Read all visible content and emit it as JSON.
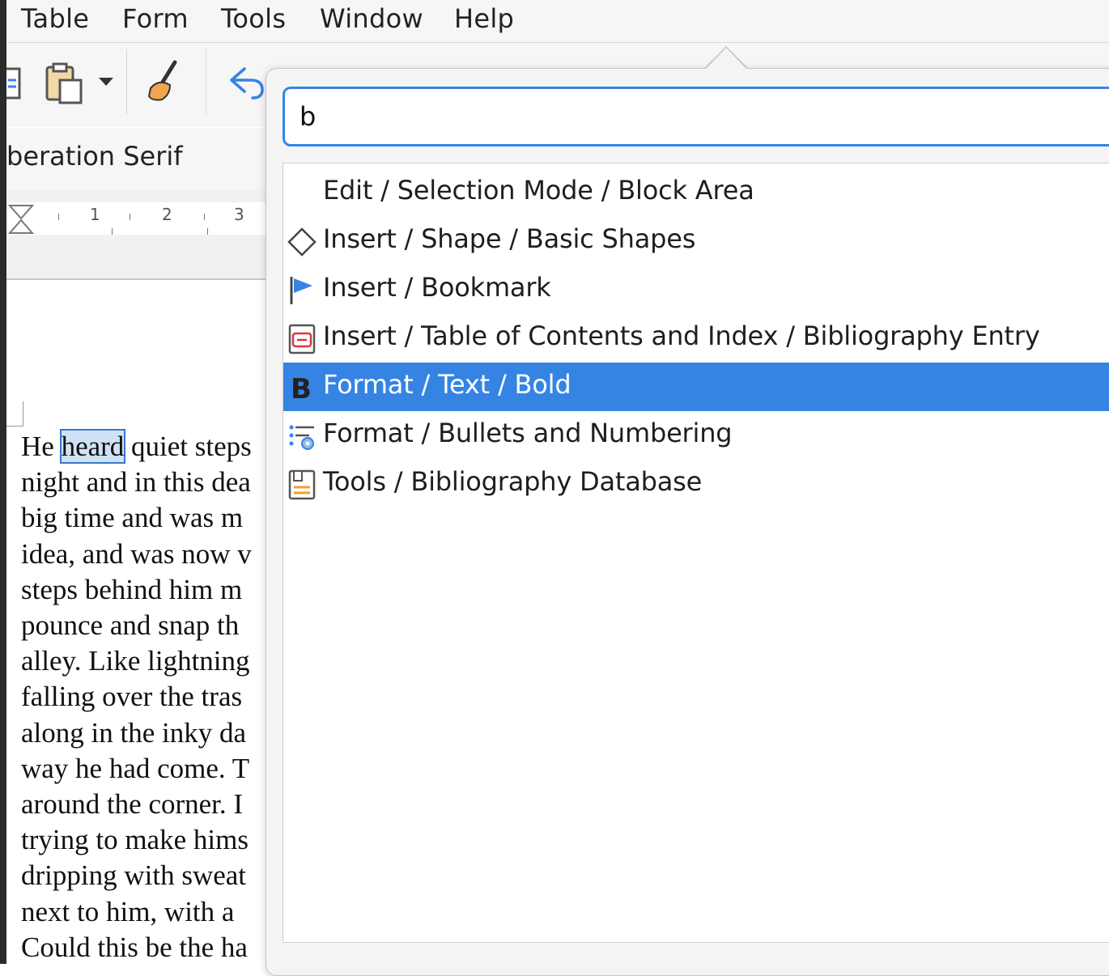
{
  "menubar": {
    "items": [
      "Table",
      "Form",
      "Tools",
      "Window",
      "Help"
    ]
  },
  "toolbar": {
    "font_name": "Liberation Serif",
    "font_name_visible": "beration Serif"
  },
  "ruler": {
    "numbers": [
      "1",
      "2",
      "3"
    ]
  },
  "document": {
    "lines": [
      {
        "before": "He ",
        "selected": "heard",
        "after": " quiet steps"
      },
      {
        "text": "night and in this dea"
      },
      {
        "text": "big time and was m"
      },
      {
        "text": "idea, and was now v"
      },
      {
        "text": "steps behind him m"
      },
      {
        "text": "pounce and snap th"
      },
      {
        "text": "alley. Like lightning"
      },
      {
        "text": "falling over the tras"
      },
      {
        "text": "along in the inky da"
      },
      {
        "text": "way he had come. T"
      },
      {
        "text": "around the corner. I"
      },
      {
        "text": "trying to make hims"
      },
      {
        "text": "dripping with sweat"
      },
      {
        "text": "next to him, with a"
      },
      {
        "text": "Could this be the ha"
      }
    ]
  },
  "command_popup": {
    "search_value": "b",
    "results": [
      {
        "label": "Edit / Selection Mode / Block Area",
        "icon": "none",
        "selected": false
      },
      {
        "label": "Insert / Shape / Basic Shapes",
        "icon": "diamond-shape-icon",
        "selected": false
      },
      {
        "label": "Insert / Bookmark",
        "icon": "bookmark-flag-icon",
        "selected": false
      },
      {
        "label": "Insert / Table of Contents and Index / Bibliography Entry",
        "icon": "bibliography-entry-icon",
        "selected": false
      },
      {
        "label": "Format / Text / Bold",
        "icon": "bold-icon",
        "selected": true
      },
      {
        "label": "Format / Bullets and Numbering",
        "icon": "bullets-numbering-icon",
        "selected": false
      },
      {
        "label": "Tools / Bibliography Database",
        "icon": "bibliography-database-icon",
        "selected": false
      }
    ],
    "accent_color": "#3584e4"
  }
}
